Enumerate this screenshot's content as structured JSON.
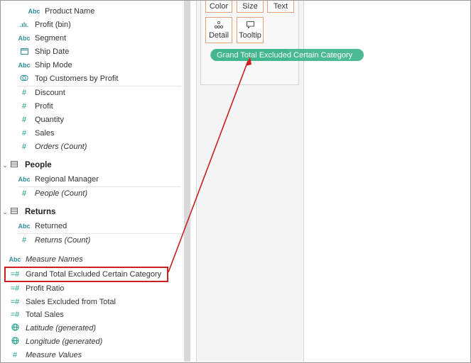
{
  "data_pane": {
    "orders_fields": [
      {
        "label": "Product Name",
        "icon": "Abc",
        "italic": false
      },
      {
        "label": "Profit (bin)",
        "icon": ".ılı.",
        "italic": false
      },
      {
        "label": "Segment",
        "icon": "Abc",
        "italic": false
      },
      {
        "label": "Ship Date",
        "icon": "calendar-icon",
        "italic": false
      },
      {
        "label": "Ship Mode",
        "icon": "Abc",
        "italic": false
      },
      {
        "label": "Top Customers by Profit",
        "icon": "set-icon",
        "italic": false
      },
      {
        "label": "Discount",
        "icon": "#",
        "italic": false
      },
      {
        "label": "Profit",
        "icon": "#",
        "italic": false
      },
      {
        "label": "Quantity",
        "icon": "#",
        "italic": false
      },
      {
        "label": "Sales",
        "icon": "#",
        "italic": false
      },
      {
        "label": "Orders (Count)",
        "icon": "#",
        "italic": true
      }
    ],
    "people": {
      "name": "People",
      "fields": [
        {
          "label": "Regional Manager",
          "icon": "Abc",
          "italic": false
        },
        {
          "label": "People (Count)",
          "icon": "#",
          "italic": true
        }
      ]
    },
    "returns": {
      "name": "Returns",
      "fields": [
        {
          "label": "Returned",
          "icon": "Abc",
          "italic": false
        },
        {
          "label": "Returns (Count)",
          "icon": "#",
          "italic": true
        }
      ]
    },
    "bottom_fields": [
      {
        "label": "Measure Names",
        "icon": "Abc",
        "italic": true
      },
      {
        "label": "Grand Total Excluded Certain Category",
        "icon": "=#",
        "italic": false
      },
      {
        "label": "Profit Ratio",
        "icon": "=#",
        "italic": false
      },
      {
        "label": "Sales Excluded from Total",
        "icon": "=#",
        "italic": false
      },
      {
        "label": "Total Sales",
        "icon": "=#",
        "italic": false
      },
      {
        "label": "Latitude (generated)",
        "icon": "globe-icon",
        "italic": true
      },
      {
        "label": "Longitude (generated)",
        "icon": "globe-icon",
        "italic": true
      },
      {
        "label": "Measure Values",
        "icon": "#",
        "italic": true
      }
    ]
  },
  "marks_card": {
    "buttons": [
      "Color",
      "Size",
      "Text"
    ],
    "detail_label": "Detail",
    "tooltip_label": "Tooltip"
  },
  "drag_pill": {
    "label": "Grand Total Excluded Certain Category",
    "color": "#3db58a"
  },
  "colors": {
    "highlight": "#cc1f1f",
    "measure_icon": "#16a085",
    "dimension_icon": "#2e8f9e"
  }
}
